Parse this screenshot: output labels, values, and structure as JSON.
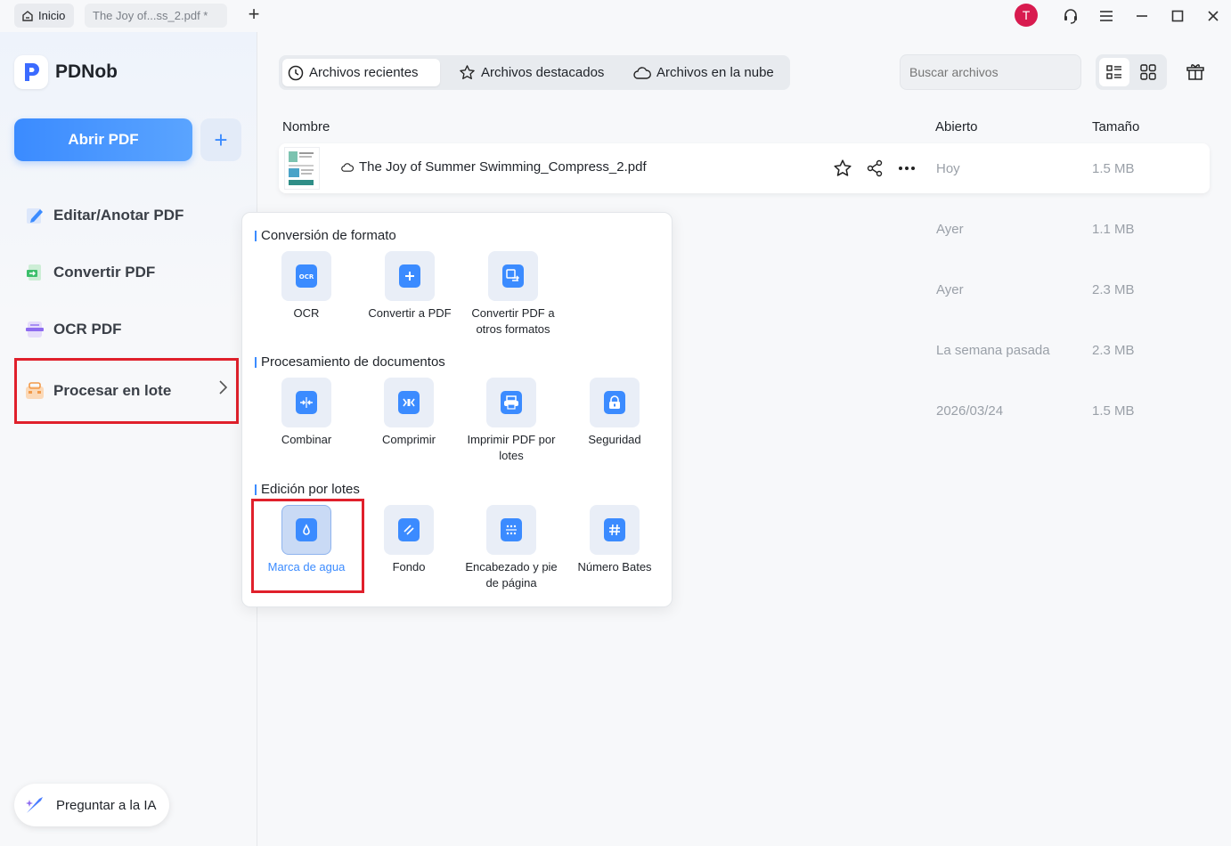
{
  "titlebar": {
    "home_tab": "Inicio",
    "doc_tab": "The Joy of...ss_2.pdf *",
    "avatar_initial": "T"
  },
  "sidebar": {
    "app_name": "PDNob",
    "open_button": "Abrir PDF",
    "items": [
      {
        "label": "Editar/Anotar PDF",
        "icon": "edit-icon"
      },
      {
        "label": "Convertir PDF",
        "icon": "convert-icon"
      },
      {
        "label": "OCR PDF",
        "icon": "ocr-icon"
      },
      {
        "label": "Procesar en lote",
        "icon": "batch-icon",
        "selected": true
      }
    ],
    "ai_button": "Preguntar a la IA"
  },
  "toolbar": {
    "tabs": [
      "Archivos recientes",
      "Archivos destacados",
      "Archivos en la nube"
    ],
    "search_placeholder": "Buscar archivos"
  },
  "table": {
    "headers": {
      "name": "Nombre",
      "opened": "Abierto",
      "size": "Tamaño"
    },
    "rows": [
      {
        "name": "The Joy of Summer Swimming_Compress_2.pdf",
        "opened": "Hoy",
        "size": "1.5 MB"
      },
      {
        "name": "",
        "opened": "Ayer",
        "size": "1.1 MB"
      },
      {
        "name": "",
        "opened": "Ayer",
        "size": "2.3 MB"
      },
      {
        "name": "",
        "opened": "La semana pasada",
        "size": "2.3 MB"
      },
      {
        "name": "",
        "opened": "2026/03/24",
        "size": "1.5 MB"
      }
    ]
  },
  "popup": {
    "sections": [
      {
        "title": "Conversión de formato",
        "tools": [
          "OCR",
          "Convertir a PDF",
          "Convertir PDF a otros formatos"
        ]
      },
      {
        "title": "Procesamiento de documentos",
        "tools": [
          "Combinar",
          "Comprimir",
          "Imprimir PDF por lotes",
          "Seguridad"
        ]
      },
      {
        "title": "Edición por lotes",
        "tools": [
          "Marca de agua",
          "Fondo",
          "Encabezado y pie de página",
          "Número Bates"
        ]
      }
    ]
  },
  "colors": {
    "accent": "#3b8bff",
    "highlight_frame": "#e0202b",
    "avatar": "#d81b4f"
  }
}
